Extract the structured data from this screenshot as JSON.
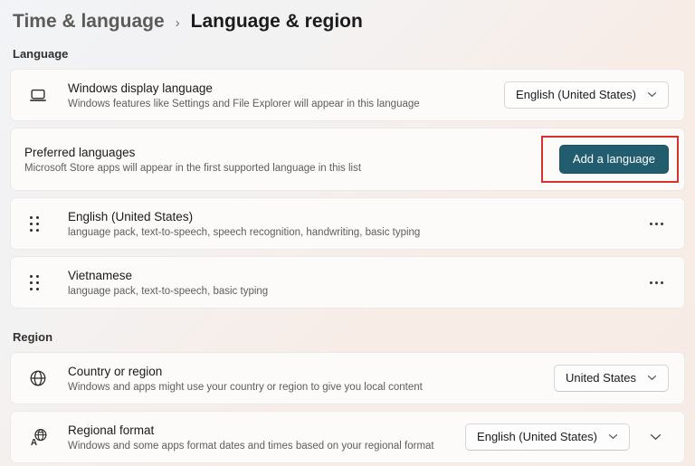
{
  "breadcrumb": {
    "parent": "Time & language",
    "separator": "›",
    "current": "Language & region"
  },
  "language_section": {
    "label": "Language",
    "display_language": {
      "title": "Windows display language",
      "description": "Windows features like Settings and File Explorer will appear in this language",
      "dropdown_value": "English (United States)",
      "icon": "laptop-display-icon"
    },
    "preferred_languages": {
      "title": "Preferred languages",
      "description": "Microsoft Store apps will appear in the first supported language in this list",
      "button_label": "Add a language"
    },
    "language_items": [
      {
        "title": "English (United States)",
        "description": "language pack, text-to-speech, speech recognition, handwriting, basic typing",
        "drag_icon": "drag-handle-dots",
        "menu_icon": "ellipsis-menu"
      },
      {
        "title": "Vietnamese",
        "description": "language pack, text-to-speech, basic typing",
        "drag_icon": "drag-handle-dots",
        "menu_icon": "ellipsis-menu"
      }
    ]
  },
  "region_section": {
    "label": "Region",
    "country": {
      "title": "Country or region",
      "description": "Windows and apps might use your country or region to give you local content",
      "dropdown_value": "United States",
      "icon": "globe-icon"
    },
    "regional_format": {
      "title": "Regional format",
      "description": "Windows and some apps format dates and times based on your regional format",
      "dropdown_value": "English (United States)",
      "icon": "translate-globe-icon"
    }
  },
  "colors": {
    "accent_button": "#215d6e",
    "highlight_border": "#d9322b",
    "card_background": "#fcfbfa"
  }
}
